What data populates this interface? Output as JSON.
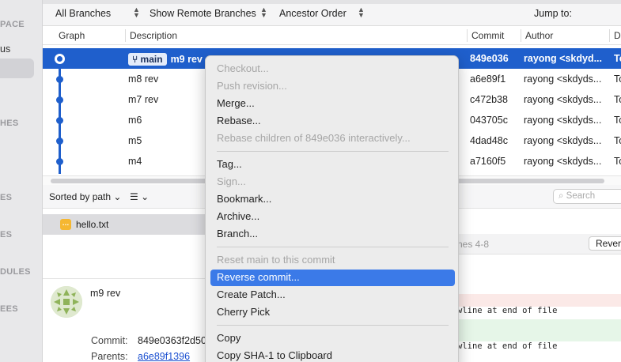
{
  "sidebar": {
    "sections": [
      "PACE",
      "HES",
      "ES",
      "ES",
      "DULES",
      "EES"
    ],
    "items": [
      "us"
    ]
  },
  "filters": {
    "branches": "All Branches",
    "remote": "Show Remote Branches",
    "order": "Ancestor Order",
    "jump": "Jump to:"
  },
  "columns": {
    "graph": "Graph",
    "description": "Description",
    "commit": "Commit",
    "author": "Author",
    "date": "D"
  },
  "commits": [
    {
      "branch": "main",
      "desc": "m9 rev",
      "hash": "849e036",
      "author": "rayong <skdyd...",
      "tail": "To"
    },
    {
      "desc": "m8 rev",
      "hash": "a6e89f1",
      "author": "rayong <skdyds...",
      "tail": "To"
    },
    {
      "desc": "m7 rev",
      "hash": "c472b38",
      "author": "rayong <skdyds...",
      "tail": "To"
    },
    {
      "desc": "m6",
      "hash": "043705c",
      "author": "rayong <skdyds...",
      "tail": "To"
    },
    {
      "desc": "m5",
      "hash": "4dad48c",
      "author": "rayong <skdyds...",
      "tail": "To"
    },
    {
      "desc": "m4",
      "hash": "a7160f5",
      "author": "rayong <skdyds...",
      "tail": "To"
    }
  ],
  "files": {
    "sort": "Sorted by path",
    "search_placeholder": "Search",
    "list": [
      "hello.txt"
    ]
  },
  "diff": {
    "lines_label": "nes 4-8",
    "reverse": "Reverse",
    "line1": "wline at end of file",
    "line2": "wline at end of file"
  },
  "detail": {
    "subject": "m9 rev",
    "commit_label": "Commit:",
    "commit_value": "849e0363f2d50",
    "parents_label": "Parents:",
    "parents_value": "a6e89f1396"
  },
  "menu": {
    "checkout": "Checkout...",
    "push": "Push revision...",
    "merge": "Merge...",
    "rebase": "Rebase...",
    "rebase_children": "Rebase children of 849e036 interactively...",
    "tag": "Tag...",
    "sign": "Sign...",
    "bookmark": "Bookmark...",
    "archive": "Archive...",
    "branch": "Branch...",
    "reset": "Reset main to this commit",
    "reverse": "Reverse commit...",
    "patch": "Create Patch...",
    "cherry": "Cherry Pick",
    "copy": "Copy",
    "copy_sha": "Copy SHA-1 to Clipboard"
  }
}
